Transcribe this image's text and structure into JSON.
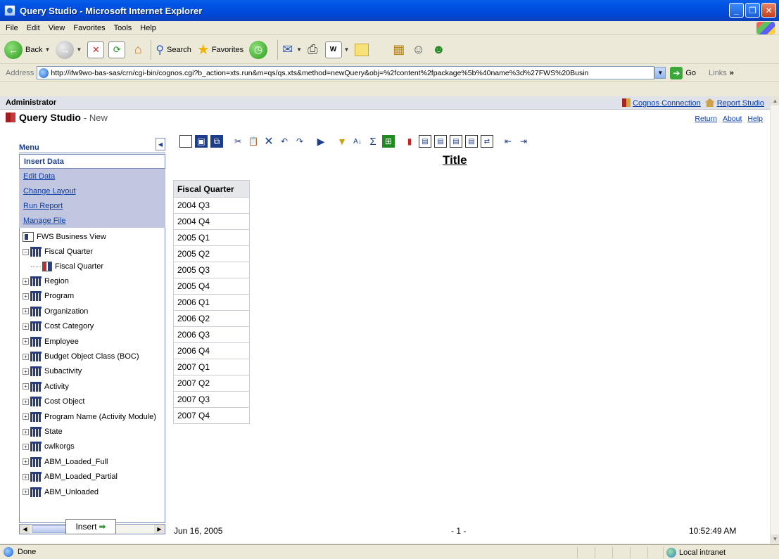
{
  "window": {
    "title": "Query Studio - Microsoft Internet Explorer"
  },
  "ie_menu": [
    "File",
    "Edit",
    "View",
    "Favorites",
    "Tools",
    "Help"
  ],
  "ie_toolbar": {
    "back": "Back",
    "search": "Search",
    "favorites": "Favorites"
  },
  "address": {
    "label": "Address",
    "url": "http://ifw9wo-bas-sas/crn/cgi-bin/cognos.cgi?b_action=xts.run&m=qs/qs.xts&method=newQuery&obj=%2fcontent%2fpackage%5b%40name%3d%27FWS%20Busin",
    "go": "Go",
    "links": "Links"
  },
  "header": {
    "user": "Administrator",
    "cognos_connection": "Cognos Connection",
    "report_studio": "Report Studio"
  },
  "studio": {
    "name": "Query Studio",
    "subtitle": "- New",
    "return": "Return",
    "about": "About",
    "help": "Help"
  },
  "menu": {
    "label": "Menu",
    "items": [
      "Insert Data",
      "Edit Data",
      "Change Layout",
      "Run Report",
      "Manage File"
    ]
  },
  "tree": {
    "root": "FWS Business View",
    "expanded": "Fiscal Quarter",
    "child": "Fiscal Quarter",
    "items": [
      "Region",
      "Program",
      "Organization",
      "Cost Category",
      "Employee",
      "Budget Object Class (BOC)",
      "Subactivity",
      "Activity",
      "Cost Object",
      "Program Name (Activity Module)",
      "State",
      "cwlkorgs",
      "ABM_Loaded_Full",
      "ABM_Loaded_Partial",
      "ABM_Unloaded"
    ]
  },
  "insert_button": "Insert",
  "report": {
    "title": "Title",
    "column_header": "Fiscal Quarter",
    "rows": [
      "2004 Q3",
      "2004 Q4",
      "2005 Q1",
      "2005 Q2",
      "2005 Q3",
      "2005 Q4",
      "2006 Q1",
      "2006 Q2",
      "2006 Q3",
      "2006 Q4",
      "2007 Q1",
      "2007 Q2",
      "2007 Q3",
      "2007 Q4"
    ],
    "footer_date": "Jun 16, 2005",
    "footer_page": "- 1 -",
    "footer_time": "10:52:49 AM"
  },
  "status": {
    "text": "Done",
    "zone": "Local intranet"
  }
}
